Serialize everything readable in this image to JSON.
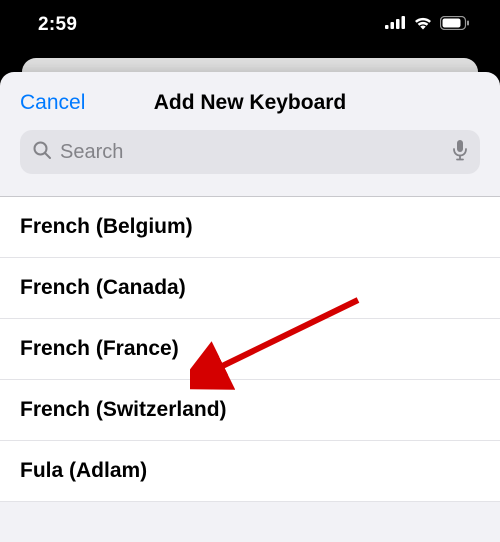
{
  "status_bar": {
    "time": "2:59"
  },
  "header": {
    "cancel_label": "Cancel",
    "title": "Add New Keyboard"
  },
  "search": {
    "placeholder": "Search"
  },
  "keyboards": [
    {
      "label": "French (Belgium)"
    },
    {
      "label": "French (Canada)"
    },
    {
      "label": "French (France)"
    },
    {
      "label": "French (Switzerland)"
    },
    {
      "label": "Fula (Adlam)"
    }
  ],
  "colors": {
    "accent": "#007aff"
  }
}
